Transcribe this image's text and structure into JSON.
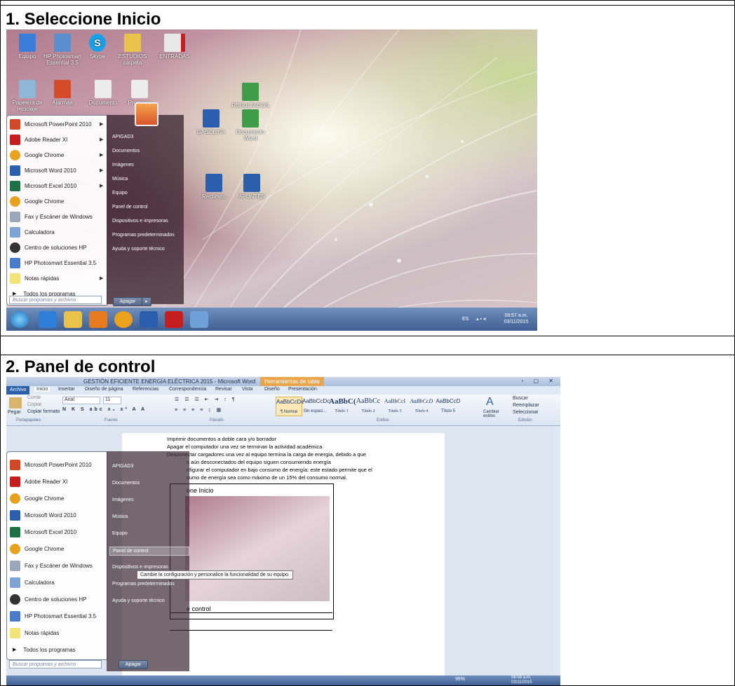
{
  "steps": [
    {
      "title": "1.  Seleccione Inicio"
    },
    {
      "title": "2.  Panel de control"
    }
  ],
  "desktop": {
    "icons": [
      {
        "label": "Equipo",
        "color": "#3b7dd8"
      },
      {
        "label": "HP Photosmart Essential 3.5",
        "color": "#5a8ecf"
      },
      {
        "label": "Skype",
        "color": "#1aa0e6"
      },
      {
        "label": "ESTUDIOS carpeta",
        "color": "#e8c24a"
      },
      {
        "label": "ENTRADAS",
        "color": "#e8e8e8"
      },
      {
        "label": "Papelera de reciclaje",
        "color": "#8fb7d8"
      },
      {
        "label": "Alarmas",
        "color": "#d44b2a"
      },
      {
        "label": "Documento",
        "color": "#ececec"
      },
      {
        "label": "Procesos",
        "color": "#ececec"
      },
      {
        "label": "RESULTADOS",
        "color": "#3f9d4a"
      },
      {
        "label": "GASOLINA",
        "color": "#2b5fae"
      },
      {
        "label": "Documento Word",
        "color": "#3f9d4a"
      },
      {
        "label": "Recursos",
        "color": "#2b5fae"
      },
      {
        "label": "APUNTES",
        "color": "#2b5fae"
      }
    ]
  },
  "start_menu": {
    "programs": [
      {
        "label": "Microsoft PowerPoint 2010",
        "color": "#d24726",
        "arrow": true
      },
      {
        "label": "Adobe Reader XI",
        "color": "#c41e1e",
        "arrow": true
      },
      {
        "label": "Google Chrome",
        "color": "#e8a21b",
        "arrow": true
      },
      {
        "label": "Microsoft Word 2010",
        "color": "#2b5fae",
        "arrow": true
      },
      {
        "label": "Microsoft Excel 2010",
        "color": "#1e7145",
        "arrow": true
      },
      {
        "label": "Google Chrome",
        "color": "#e8a21b",
        "arrow": false
      },
      {
        "label": "Fax y Escáner de Windows",
        "color": "#9aa7b8",
        "arrow": false
      },
      {
        "label": "Calculadora",
        "color": "#7ea4d6",
        "arrow": false
      },
      {
        "label": "Centro de soluciones HP",
        "color": "#333333",
        "arrow": false
      },
      {
        "label": "HP Photosmart Essential 3.5",
        "color": "#4a7bc8",
        "arrow": false
      },
      {
        "label": "Notas rápidas",
        "color": "#f1e27a",
        "arrow": true
      }
    ],
    "all_programs": "Todos los programas",
    "search_placeholder": "Buscar programas y archivos",
    "right_links": [
      "APIGAD3",
      "Documentos",
      "Imágenes",
      "Música",
      "Equipo",
      "Panel de control",
      "Dispositivos e impresoras",
      "Programas predeterminados",
      "Ayuda y soporte técnico"
    ],
    "shutdown": "Apagar",
    "tooltip": "Cambie la configuración y personalice la funcionalidad de su equipo."
  },
  "taskbar": {
    "time1": "08:57 a.m.",
    "date1": "03/11/2015",
    "time2": "08:58 a.m.",
    "date2": "03/11/2015",
    "lang": "ES",
    "apps": [
      {
        "name": "start-orb",
        "color": "#3da0e0"
      },
      {
        "name": "ie",
        "color": "#2f7fd8"
      },
      {
        "name": "explorer",
        "color": "#e8c24a"
      },
      {
        "name": "media",
        "color": "#e57b1e"
      },
      {
        "name": "chrome",
        "color": "#e8a21b"
      },
      {
        "name": "word",
        "color": "#2b5fae"
      },
      {
        "name": "adobe",
        "color": "#c41e1e"
      },
      {
        "name": "network",
        "color": "#6fa0d8"
      }
    ]
  },
  "word": {
    "title": "GESTIÓN EFICIENTE ENERGÍA ELÉCTRICA 2015 - Microsoft Word",
    "context_tab": "Herramientas de tabla",
    "tabs": [
      "Archivo",
      "Inicio",
      "Insertar",
      "Diseño de página",
      "Referencias",
      "Correspondencia",
      "Revisar",
      "Vista",
      "Diseño",
      "Presentación"
    ],
    "clipboard": {
      "paste": "Pegar",
      "cut": "Cortar",
      "copy": "Copiar",
      "format": "Copiar formato",
      "group": "Portapapeles"
    },
    "font": {
      "name": "Arial",
      "size": "11",
      "group": "Fuente"
    },
    "paragraph_group": "Párrafo",
    "styles": [
      {
        "sample": "AaBbCcDc",
        "name": "¶ Normal"
      },
      {
        "sample": "AaBbCcDc",
        "name": "Sin espaci..."
      },
      {
        "sample": "AaBbC(",
        "name": "Título 1"
      },
      {
        "sample": "AaBbCc",
        "name": "Título 2"
      },
      {
        "sample": "AaBbCcI",
        "name": "Título 3"
      },
      {
        "sample": "AaBbCcD",
        "name": "Título 4"
      },
      {
        "sample": "AaBbCcD",
        "name": "Título 5"
      }
    ],
    "styles_group": "Estilos",
    "change_styles": "Cambiar estilos",
    "editing": {
      "find": "Buscar",
      "replace": "Reemplazar",
      "select": "Seleccionar",
      "group": "Edición"
    },
    "body_lines": [
      "Imprimir documentos a doble cara y/o borrador",
      "Apagar el computador una vez se terminan la actividad académica",
      "Desconectar cargadores una vez al equipo termina la carga  de energía, debido a que",
      "s aún desconectados del equipo siguen consumiendo energía",
      "nfigurar el computador en bajo consumo de energía: este estado permite que el",
      "sumo de energía sea como máximo de un 15% del consumo normal."
    ],
    "table_row1": "one Inicio",
    "table_row2": "e control",
    "zoom": "96%"
  }
}
